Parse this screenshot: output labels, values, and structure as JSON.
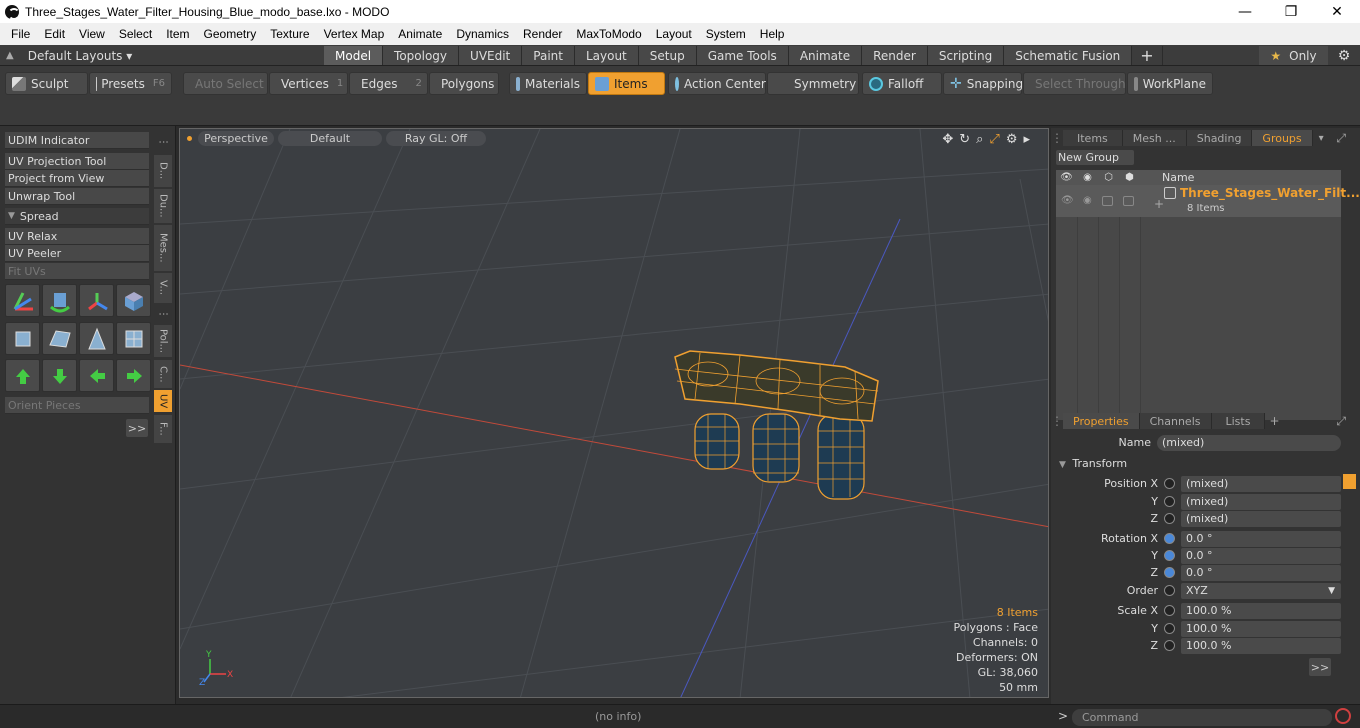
{
  "window": {
    "title": "Three_Stages_Water_Filter_Housing_Blue_modo_base.lxo - MODO",
    "minimize": "—",
    "maximize": "❐",
    "close": "✕"
  },
  "menu": [
    "File",
    "Edit",
    "View",
    "Select",
    "Item",
    "Geometry",
    "Texture",
    "Vertex Map",
    "Animate",
    "Dynamics",
    "Render",
    "MaxToModo",
    "Layout",
    "System",
    "Help"
  ],
  "layout_bar": {
    "default_layouts": "Default Layouts ▾",
    "tabs": [
      "Model",
      "Topology",
      "UVEdit",
      "Paint",
      "Layout",
      "Setup",
      "Game Tools",
      "Animate",
      "Render",
      "Scripting",
      "Schematic Fusion"
    ],
    "active_tab": "Model",
    "only": "Only"
  },
  "toolbar": {
    "sculpt": "Sculpt",
    "presets": "Presets",
    "presets_key": "F6",
    "auto_select": "Auto Select",
    "vertices": "Vertices",
    "vertices_num": "1",
    "edges": "Edges",
    "edges_num": "2",
    "polygons": "Polygons",
    "materials": "Materials",
    "items": "Items",
    "action_center": "Action Center",
    "symmetry": "Symmetry",
    "falloff": "Falloff",
    "snapping": "Snapping",
    "select_through": "Select Through",
    "workplane": "WorkPlane"
  },
  "left_panel": {
    "udim": "UDIM Indicator",
    "uv_projection": "UV Projection Tool",
    "project_from_view": "Project from View",
    "unwrap": "Unwrap Tool",
    "spread": "Spread",
    "uv_relax": "UV Relax",
    "uv_peeler": "UV Peeler",
    "fit_uvs": "Fit UVs",
    "orient_pieces": "Orient Pieces",
    "more": ">>",
    "vtabs": [
      "D...",
      "Du...",
      "Mes...",
      "V...",
      "Pol...",
      "C...",
      "UV",
      "F..."
    ]
  },
  "viewport": {
    "perspective": "Perspective",
    "default": "Default",
    "raygl": "Ray GL: Off",
    "info": {
      "items": "8 Items",
      "polygons": "Polygons : Face",
      "channels": "Channels: 0",
      "deformers": "Deformers: ON",
      "gl": "GL: 38,060",
      "size": "50 mm"
    }
  },
  "right_panel": {
    "top_tabs": [
      "Items",
      "Mesh ...",
      "Shading",
      "Groups"
    ],
    "active_top": "Groups",
    "new_group": "New Group",
    "name_col": "Name",
    "group_name": "Three_Stages_Water_Filt...",
    "group_count": "8 Items",
    "prop_tabs": [
      "Properties",
      "Channels",
      "Lists"
    ],
    "name_label": "Name",
    "name_value": "(mixed)",
    "transform": "Transform",
    "position_x": "Position X",
    "y": "Y",
    "z": "Z",
    "pos_x": "(mixed)",
    "pos_y": "(mixed)",
    "pos_z": "(mixed)",
    "rotation_x": "Rotation X",
    "rot_x": "0.0 °",
    "rot_y": "0.0 °",
    "rot_z": "0.0 °",
    "order_label": "Order",
    "order_value": "XYZ",
    "scale_x": "Scale X",
    "scl_x": "100.0 %",
    "scl_y": "100.0 %",
    "scl_z": "100.0 %",
    "more": ">>"
  },
  "status": {
    "info": "(no info)",
    "command_placeholder": "Command",
    "prompt": ">"
  }
}
